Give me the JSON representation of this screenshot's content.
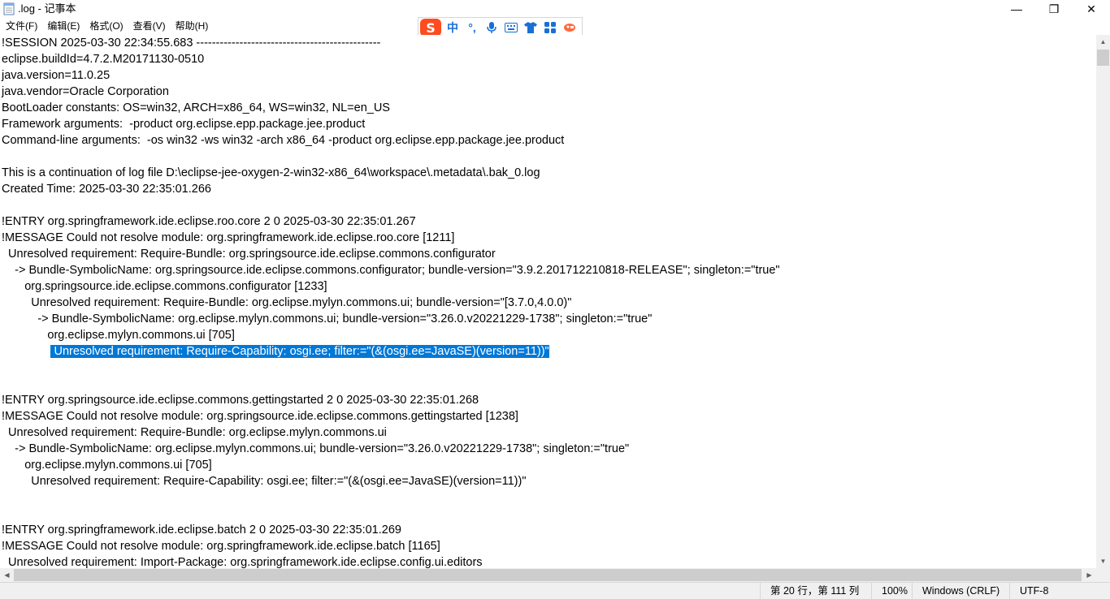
{
  "window": {
    "title": ".log - 记事本",
    "minimize_glyph": "—",
    "maximize_glyph": "❐",
    "close_glyph": "✕"
  },
  "menu": [
    "文件(F)",
    "编辑(E)",
    "格式(O)",
    "查看(V)",
    "帮助(H)"
  ],
  "ime_toolbar": {
    "logo": "S",
    "items": [
      "中",
      "°,",
      "mic-icon",
      "keyboard-icon",
      "shirt-icon",
      "grid-icon",
      "tool-icon"
    ],
    "mode_label": "中",
    "punct_label": "°,"
  },
  "editor": {
    "lines": [
      "!SESSION 2025-03-30 22:34:55.683 -----------------------------------------------",
      "eclipse.buildId=4.7.2.M20171130-0510",
      "java.version=11.0.25",
      "java.vendor=Oracle Corporation",
      "BootLoader constants: OS=win32, ARCH=x86_64, WS=win32, NL=en_US",
      "Framework arguments:  -product org.eclipse.epp.package.jee.product",
      "Command-line arguments:  -os win32 -ws win32 -arch x86_64 -product org.eclipse.epp.package.jee.product",
      "",
      "This is a continuation of log file D:\\eclipse-jee-oxygen-2-win32-x86_64\\workspace\\.metadata\\.bak_0.log",
      "Created Time: 2025-03-30 22:35:01.266",
      "",
      "!ENTRY org.springframework.ide.eclipse.roo.core 2 0 2025-03-30 22:35:01.267",
      "!MESSAGE Could not resolve module: org.springframework.ide.eclipse.roo.core [1211]",
      "  Unresolved requirement: Require-Bundle: org.springsource.ide.eclipse.commons.configurator",
      "    -> Bundle-SymbolicName: org.springsource.ide.eclipse.commons.configurator; bundle-version=\"3.9.2.201712210818-RELEASE\"; singleton:=\"true\"",
      "       org.springsource.ide.eclipse.commons.configurator [1233]",
      "         Unresolved requirement: Require-Bundle: org.eclipse.mylyn.commons.ui; bundle-version=\"[3.7.0,4.0.0)\"",
      "           -> Bundle-SymbolicName: org.eclipse.mylyn.commons.ui; bundle-version=\"3.26.0.v20221229-1738\"; singleton:=\"true\"",
      "              org.eclipse.mylyn.commons.ui [705]",
      "",
      "",
      "",
      "!ENTRY org.springsource.ide.eclipse.commons.gettingstarted 2 0 2025-03-30 22:35:01.268",
      "!MESSAGE Could not resolve module: org.springsource.ide.eclipse.commons.gettingstarted [1238]",
      "  Unresolved requirement: Require-Bundle: org.eclipse.mylyn.commons.ui",
      "    -> Bundle-SymbolicName: org.eclipse.mylyn.commons.ui; bundle-version=\"3.26.0.v20221229-1738\"; singleton:=\"true\"",
      "       org.eclipse.mylyn.commons.ui [705]",
      "         Unresolved requirement: Require-Capability: osgi.ee; filter:=\"(&(osgi.ee=JavaSE)(version=11))\"",
      "",
      "",
      "!ENTRY org.springframework.ide.eclipse.batch 2 0 2025-03-30 22:35:01.269",
      "!MESSAGE Could not resolve module: org.springframework.ide.eclipse.batch [1165]",
      "  Unresolved requirement: Import-Package: org.springframework.ide.eclipse.config.ui.editors"
    ],
    "selected_line_prefix": "               ",
    "selected_text": " Unresolved requirement: Require-Capability: osgi.ee; filter:=\"(&(osgi.ee=JavaSE)(version=11))\"",
    "selection_color": "#0078d7"
  },
  "statusbar": {
    "position": "第 20 行，第 111 列",
    "zoom": "100%",
    "line_ending": "Windows (CRLF)",
    "encoding": "UTF-8"
  },
  "scrollbars": {
    "up": "▲",
    "down": "▼",
    "left": "◀",
    "right": "▶"
  }
}
